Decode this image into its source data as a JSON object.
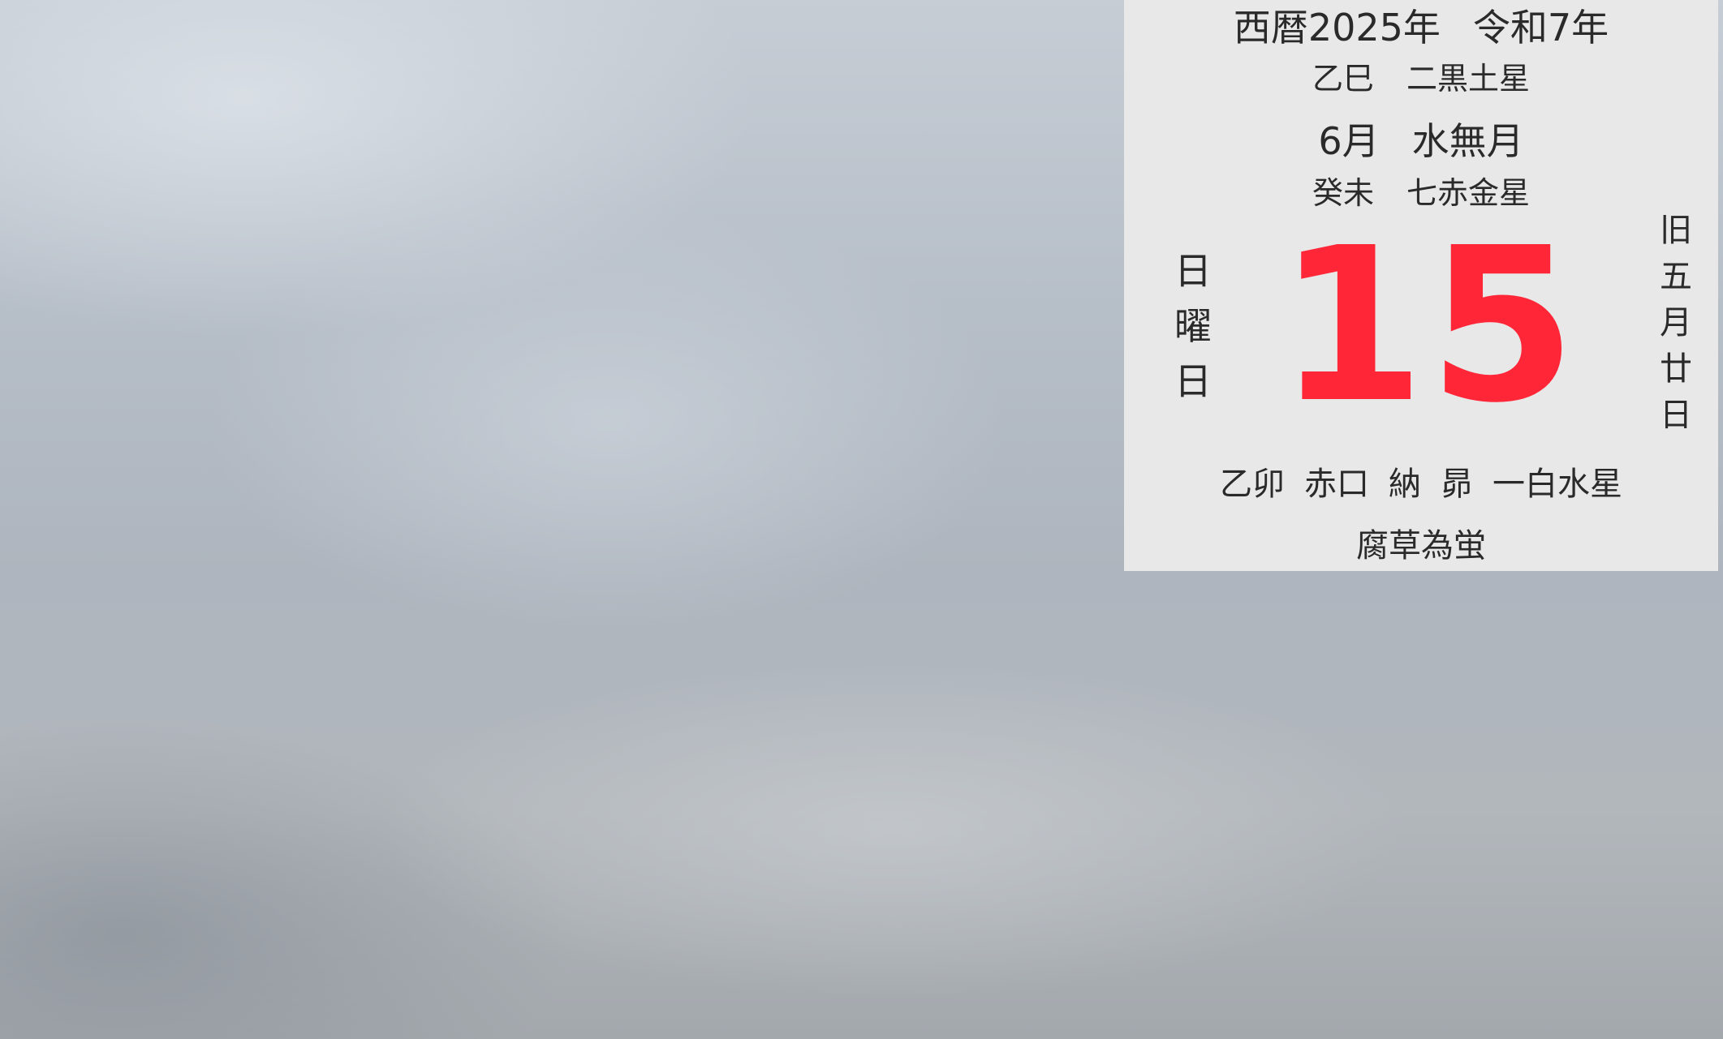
{
  "wallpaper": "overcast-sky-photo",
  "calendar": {
    "western_year": "西暦2025年",
    "era_year": "令和7年",
    "year_kanshi": "乙巳",
    "year_star": "二黒土星",
    "month": "6月",
    "month_name": "水無月",
    "month_kanshi": "癸未",
    "month_star": "七赤金星",
    "weekday_chars": [
      "日",
      "曜",
      "日"
    ],
    "day": "15",
    "lunar_chars": [
      "旧",
      "五",
      "月",
      "廿",
      "日"
    ],
    "day_kanshi": "乙卯",
    "rokuyo": "赤口",
    "juni_choku": "納",
    "nijuhachi_shuku": "昴",
    "day_star": "一白水星",
    "sekki_kou": "腐草為蛍",
    "day_color": "#ff2638",
    "panel_color": "#e8e8e8"
  }
}
